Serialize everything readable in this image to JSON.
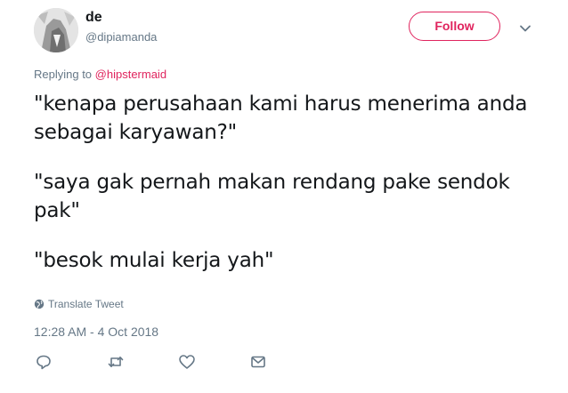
{
  "user": {
    "display_name": "de",
    "handle": "@dipiamanda",
    "avatar_icon": "avatar-photo"
  },
  "header": {
    "follow_label": "Follow",
    "menu_icon": "chevron-down-icon",
    "accent_color": "#e0245e"
  },
  "reply": {
    "prefix": "Replying to ",
    "mention": "@hipstermaid"
  },
  "tweet": {
    "paragraphs": [
      "\"kenapa perusahaan kami harus menerima anda sebagai karyawan?\"",
      "\"saya gak pernah makan rendang pake sendok pak\"",
      "\"besok mulai kerja yah\""
    ],
    "translate_label": "Translate Tweet",
    "timestamp": "12:28 AM - 4 Oct 2018"
  },
  "actions": {
    "icons": [
      "reply-icon",
      "retweet-icon",
      "like-icon",
      "message-icon"
    ]
  }
}
